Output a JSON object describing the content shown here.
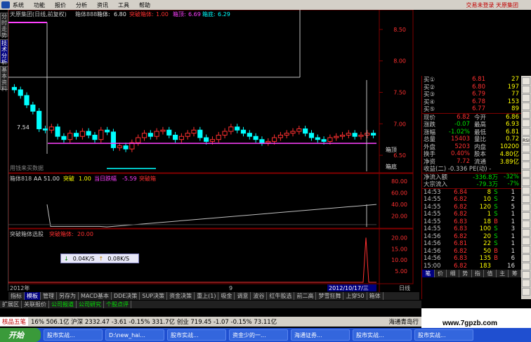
{
  "menu": {
    "items": [
      "系统",
      "功能",
      "报价",
      "分析",
      "资讯",
      "工具",
      "帮助"
    ],
    "login_status": "交易未登录",
    "broker": "天原集团"
  },
  "left_tabs": [
    "分时走势",
    "技术分析",
    "基本资料"
  ],
  "chart_header": {
    "stock": "天原集团(日线,前复权)",
    "indicator": "箱体888",
    "box_label": "箱体:",
    "box_value": "6.80",
    "break_label": "突破箱体:",
    "break_value": "1.00",
    "top_label": "箱顶:",
    "top_value": "6.69",
    "bottom_label": "箱底:",
    "bottom_value": "6.29"
  },
  "chart_data": [
    {
      "type": "candlestick",
      "title": "天原集团(日线,前复权)",
      "price_axis": [
        "8.50",
        "8.00",
        "7.50",
        "7.00",
        "6.50"
      ],
      "ylim": [
        6.3,
        8.7
      ],
      "annotation_left": "7.54",
      "watermark_text": "用钱来买数据",
      "right_labels": [
        "箱顶",
        "箱底"
      ],
      "closes": [
        7.54,
        7.45,
        7.3,
        7.2,
        6.92,
        6.9,
        6.95,
        6.8,
        6.75,
        6.85,
        6.8,
        6.88,
        6.82,
        6.75,
        6.9,
        6.87,
        6.62,
        6.65,
        6.6,
        6.7,
        6.78,
        6.85,
        6.8,
        6.88,
        6.9,
        6.82,
        6.75,
        6.8,
        6.85,
        6.9,
        6.78,
        6.72,
        6.75,
        6.82,
        6.88,
        6.95,
        6.9,
        6.85,
        6.8,
        6.75,
        6.7,
        6.72,
        6.78,
        6.82,
        6.85,
        6.88,
        6.92,
        6.85,
        6.78,
        6.75,
        6.72,
        6.78,
        6.8,
        6.82,
        6.85,
        6.8,
        6.82,
        6.85,
        6.82
      ],
      "box_top": 6.69,
      "box_bottom": 6.29
    },
    {
      "type": "line",
      "title": "箱体818",
      "series": [
        {
          "name": "AA",
          "value": "51.00"
        },
        {
          "name": "突破",
          "value": "1.00"
        },
        {
          "name": "当日跌幅",
          "value": "-5.59"
        },
        {
          "name": "突破箱",
          "value": ""
        }
      ],
      "axis": [
        "80.00",
        "60.00",
        "40.00",
        "20.00"
      ],
      "ylim": [
        0,
        90
      ]
    },
    {
      "type": "bar",
      "title": "突破箱体选股",
      "series_label": "突破箱体:",
      "series_value": "20.00",
      "axis": [
        "20.00",
        "15.00",
        "10.00",
        "5.00"
      ],
      "ylim": [
        0,
        22
      ],
      "spike_value": 20
    }
  ],
  "net_speed": {
    "down": "0.04K/S",
    "up": "0.08K/S"
  },
  "date_axis": [
    "2012年",
    "9",
    "2012/10/17/三"
  ],
  "date_axis_right": "日线",
  "quotes": {
    "buy_levels": [
      {
        "label": "买①",
        "price": "6.81",
        "vol": "27"
      },
      {
        "label": "买②",
        "price": "6.80",
        "vol": "197"
      },
      {
        "label": "买③",
        "price": "6.79",
        "vol": "77"
      },
      {
        "label": "买④",
        "price": "6.78",
        "vol": "153"
      },
      {
        "label": "买⑤",
        "price": "6.77",
        "vol": "89"
      }
    ],
    "stats": [
      {
        "l1": "现价",
        "v1": "6.82",
        "l2": "今开",
        "v2": "6.86"
      },
      {
        "l1": "涨跌",
        "v1": "-0.07",
        "l2": "最高",
        "v2": "6.93"
      },
      {
        "l1": "涨幅",
        "v1": "-1.02%",
        "l2": "最低",
        "v2": "6.81"
      },
      {
        "l1": "总量",
        "v1": "15403",
        "l2": "量比",
        "v2": "0.72"
      },
      {
        "l1": "外盘",
        "v1": "5203",
        "l2": "内盘",
        "v2": "10200"
      },
      {
        "l1": "换手",
        "v1": "0.40%",
        "l2": "股本",
        "v2": "4.80亿"
      },
      {
        "l1": "净资",
        "v1": "7.72",
        "l2": "流通",
        "v2": "3.89亿"
      }
    ],
    "earnings": "收益(二) -0.336 PE(动) -",
    "net_inflow_label": "净流入额",
    "net_inflow_value": "-336.8万",
    "net_inflow_pct": "-32%",
    "block_label": "大宗流入",
    "block_value": "-79.3万",
    "block_pct": "-7%",
    "ticks": [
      {
        "time": "14:53",
        "price": "6.84",
        "vol": "8",
        "dir": "S",
        "n": "1"
      },
      {
        "time": "14:55",
        "price": "6.82",
        "vol": "10",
        "dir": "S",
        "n": "2"
      },
      {
        "time": "14:55",
        "price": "6.82",
        "vol": "120",
        "dir": "S",
        "n": "5"
      },
      {
        "time": "14:55",
        "price": "6.82",
        "vol": "1",
        "dir": "S",
        "n": "1"
      },
      {
        "time": "14:55",
        "price": "6.83",
        "vol": "18",
        "dir": "B",
        "n": "1"
      },
      {
        "time": "14:55",
        "price": "6.83",
        "vol": "100",
        "dir": "S",
        "n": "3"
      },
      {
        "time": "14:56",
        "price": "6.82",
        "vol": "20",
        "dir": "S",
        "n": "1"
      },
      {
        "time": "14:56",
        "price": "6.81",
        "vol": "22",
        "dir": "S",
        "n": "1"
      },
      {
        "time": "14:56",
        "price": "6.82",
        "vol": "50",
        "dir": "B",
        "n": "1"
      },
      {
        "time": "14:56",
        "price": "6.83",
        "vol": "135",
        "dir": "B",
        "n": "6"
      },
      {
        "time": "15:00",
        "price": "6.82",
        "vol": "183",
        "dir": "",
        "n": "16"
      }
    ],
    "bottom_tabs": [
      "笔",
      "价",
      "细",
      "势",
      "指",
      "值",
      "主",
      "筹"
    ]
  },
  "bottom_tabs": [
    "指标",
    "模板",
    "管理",
    "另存为",
    "MACD基本",
    "DDE决策",
    "SUP决策",
    "资金决策",
    "重上(1)",
    "吸金",
    "调意",
    "波谷",
    "红牛股选",
    "前二高",
    "梦雪狂舞",
    "上穿50",
    "箱体"
  ],
  "bottom_tabs2": [
    "扩展区",
    "关联报价",
    "公司报道",
    "公司研究",
    "个股点评"
  ],
  "statusbar": {
    "left": "核品五笔",
    "items": "16%  506.1亿  沪深 2332.47  -3.61  -0.15%  331.7亿  创业 719.45  -1.07  -0.15%  73.11亿",
    "right": "海通青岛行"
  },
  "taskbar": {
    "start": "开始",
    "buttons": [
      "股市实战...",
      "D:\\new_hai...",
      "股市实战...",
      "资金少的一...",
      "海通证券...",
      "股市实战...",
      "股市实战..."
    ]
  },
  "watermark": "www.7gpzb.com",
  "right_icons": [
    "VOL",
    "RSI",
    "KD",
    "DMI"
  ]
}
